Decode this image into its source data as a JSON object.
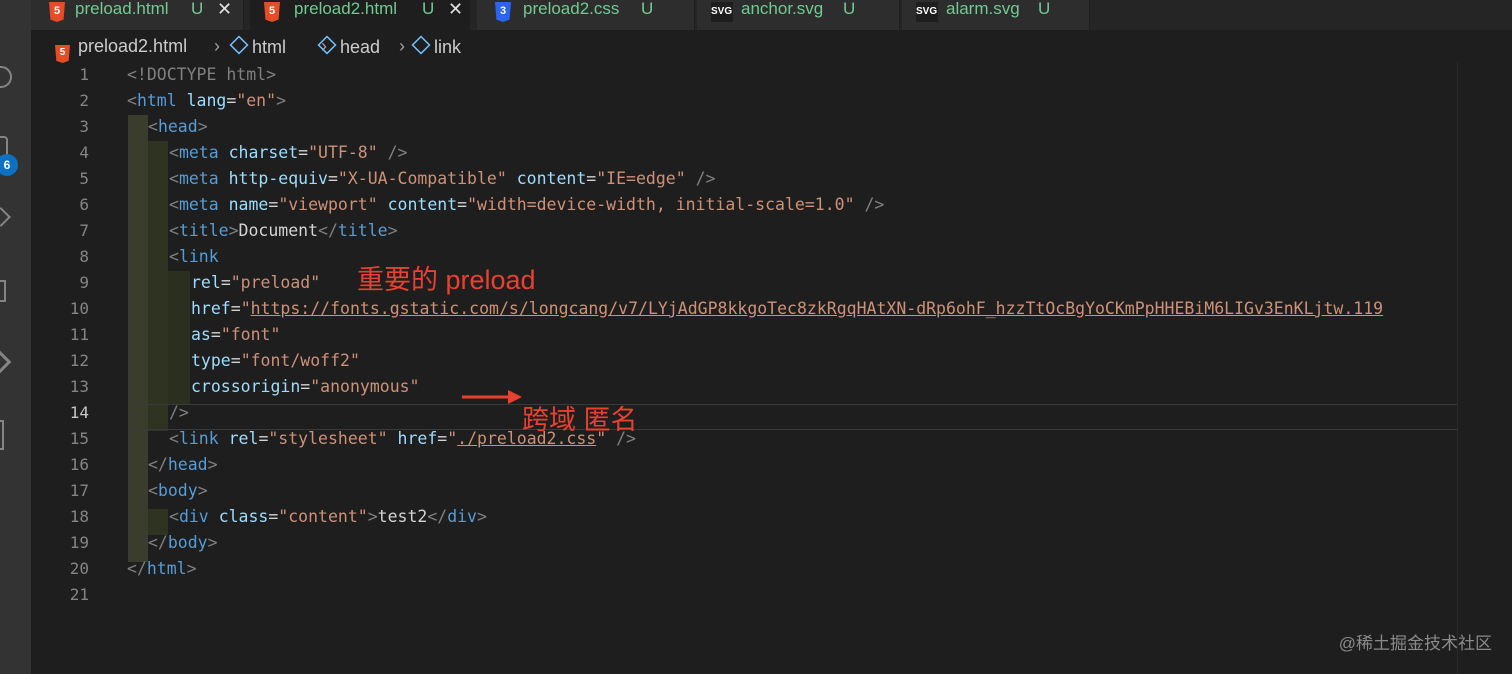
{
  "tabs": [
    {
      "icon": "html5-icon",
      "label": "preload.html",
      "status": "U",
      "close": "✕"
    },
    {
      "icon": "html5-icon",
      "label": "preload2.html",
      "status": "U",
      "close": "✕"
    },
    {
      "icon": "css3-icon",
      "label": "preload2.css",
      "status": "U"
    },
    {
      "icon": "svg-icon",
      "label": "anchor.svg",
      "status": "U"
    },
    {
      "icon": "svg-icon",
      "label": "alarm.svg",
      "status": "U"
    }
  ],
  "breadcrumb": [
    "preload2.html",
    "html",
    "head",
    "link"
  ],
  "activity_badge": "6",
  "line_numbers": [
    "1",
    "2",
    "3",
    "4",
    "5",
    "6",
    "7",
    "8",
    "9",
    "10",
    "11",
    "12",
    "13",
    "14",
    "15",
    "16",
    "17",
    "18",
    "19",
    "20",
    "21"
  ],
  "code": {
    "l1_tag": "<!DOCTYPE html>",
    "l2_lang": "\"en\"",
    "l4_charset": "\"UTF-8\"",
    "l5_http": "\"X-UA-Compatible\"",
    "l5_content": "\"IE=edge\"",
    "l6_name": "\"viewport\"",
    "l6_content": "\"width=device-width, initial-scale=1.0\"",
    "l7_title": "Document",
    "l9_rel": "\"preload\"",
    "l10_href": "https://fonts.gstatic.com/s/longcang/v7/LYjAdGP8kkgoTec8zkRgqHAtXN-dRp6ohF_hzzTtOcBgYoCKmPpHHEBiM6LIGv3EnKLjtw.119",
    "l11_as": "\"font\"",
    "l12_type": "\"font/woff2\"",
    "l13_cross": "\"anonymous\"",
    "l15_rel": "\"stylesheet\"",
    "l15_href": "./preload2.css",
    "l18_class": "\"content\"",
    "l18_text": "test2"
  },
  "annotations": {
    "preload_note": "重要的 preload",
    "crossorigin_note": "跨域 匿名"
  },
  "watermark": "@稀土掘金技术社区"
}
